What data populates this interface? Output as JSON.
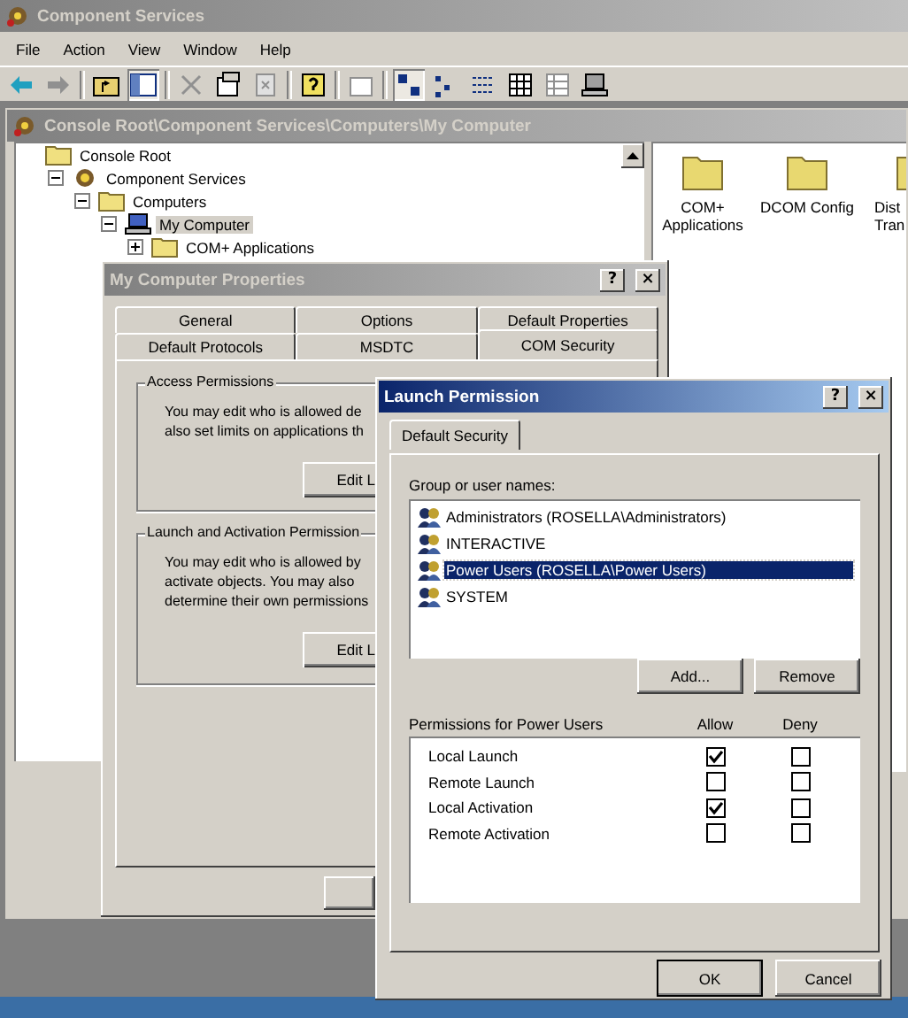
{
  "app": {
    "title": "Component Services",
    "active": false,
    "menu": [
      "File",
      "Action",
      "View",
      "Window",
      "Help"
    ]
  },
  "console": {
    "title": "Console Root\\Component Services\\Computers\\My Computer",
    "active": false,
    "tree": [
      {
        "label": "Console Root",
        "kind": "folder",
        "selected": false,
        "children": [
          {
            "label": "Component Services",
            "kind": "services",
            "expanded": true,
            "selected": false,
            "children": [
              {
                "label": "Computers",
                "kind": "folder",
                "expanded": true,
                "selected": false,
                "children": [
                  {
                    "label": "My Computer",
                    "kind": "computer",
                    "expanded": true,
                    "selected": true,
                    "children": [
                      {
                        "label": "COM+ Applications",
                        "kind": "folder",
                        "expanded": false,
                        "selected": false
                      }
                    ]
                  }
                ]
              }
            ]
          }
        ]
      }
    ],
    "items": [
      {
        "lines": [
          "COM+",
          "Applications"
        ]
      },
      {
        "lines": [
          "DCOM Config"
        ]
      },
      {
        "lines": [
          "Dist",
          "Tran"
        ]
      }
    ]
  },
  "properties": {
    "title": "My Computer Properties",
    "active": false,
    "controls": [
      "?",
      "×"
    ],
    "tab_rows": [
      [
        {
          "label": "General",
          "selected": false
        },
        {
          "label": "Options",
          "selected": false
        },
        {
          "label": "Default Properties",
          "selected": false
        }
      ],
      [
        {
          "label": "Default Protocols",
          "selected": false
        },
        {
          "label": "MSDTC",
          "selected": false
        },
        {
          "label": "COM Security",
          "selected": true
        }
      ]
    ],
    "groups": [
      {
        "title": "Access Permissions",
        "lines": [
          "You may edit who is allowed de",
          "also set limits on applications th"
        ],
        "button": "Edit L"
      },
      {
        "title": "Launch and Activation Permission",
        "lines": [
          "You may edit who is allowed by",
          "activate objects. You may also",
          "determine their own permissions"
        ],
        "button": "Edit L"
      }
    ],
    "buttons_visible": true
  },
  "launch": {
    "title": "Launch Permission",
    "active": true,
    "controls": [
      "?",
      "×"
    ],
    "tabs": [
      {
        "label": "Default Security",
        "selected": true
      }
    ],
    "users_label": "Group or user names:",
    "users": [
      {
        "name": "Administrators (ROSELLA\\Administrators)",
        "selected": false
      },
      {
        "name": "INTERACTIVE",
        "selected": false
      },
      {
        "name": "Power Users (ROSELLA\\Power Users)",
        "selected": true
      },
      {
        "name": "SYSTEM",
        "selected": false
      }
    ],
    "user_buttons": [
      "Add...",
      "Remove"
    ],
    "permissions_label": "Permissions for Power Users",
    "columns": [
      "Allow",
      "Deny"
    ],
    "permissions": [
      {
        "name": "Local Launch",
        "allow": true,
        "deny": false
      },
      {
        "name": "Remote Launch",
        "allow": false,
        "deny": false
      },
      {
        "name": "Local Activation",
        "allow": true,
        "deny": false
      },
      {
        "name": "Remote Activation",
        "allow": false,
        "deny": false
      }
    ],
    "buttons": [
      {
        "label": "OK",
        "default": true
      },
      {
        "label": "Cancel",
        "default": false
      }
    ]
  }
}
